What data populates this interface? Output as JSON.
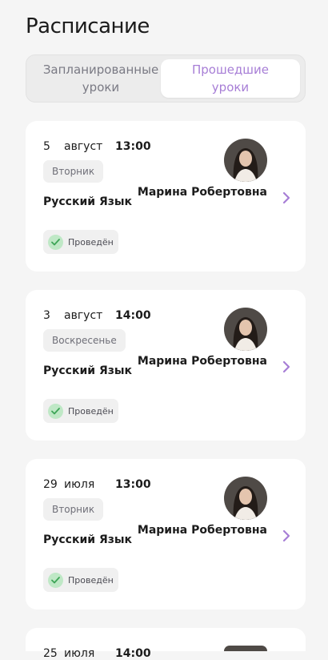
{
  "header": {
    "title": "Расписание"
  },
  "tabs": [
    {
      "label": "Запланированные\nуроки",
      "active": false
    },
    {
      "label": "Прошедшие\nуроки",
      "active": true
    }
  ],
  "lessons": [
    {
      "day": "5",
      "month": "август",
      "time": "13:00",
      "weekday": "Вторник",
      "subject": "Русский Язык",
      "teacher": "Марина Робертовна",
      "status": "Проведён"
    },
    {
      "day": "3",
      "month": "август",
      "time": "14:00",
      "weekday": "Воскресенье",
      "subject": "Русский Язык",
      "teacher": "Марина Робертовна",
      "status": "Проведён"
    },
    {
      "day": "29",
      "month": "июля",
      "time": "13:00",
      "weekday": "Вторник",
      "subject": "Русский Язык",
      "teacher": "Марина Робертовна",
      "status": "Проведён"
    },
    {
      "day": "25",
      "month": "июля",
      "time": "14:00",
      "weekday": "",
      "subject": "",
      "teacher": "",
      "status": ""
    }
  ],
  "colors": {
    "accent": "#a77ed6",
    "success": "#3ea557",
    "background": "#f5f5f5"
  }
}
